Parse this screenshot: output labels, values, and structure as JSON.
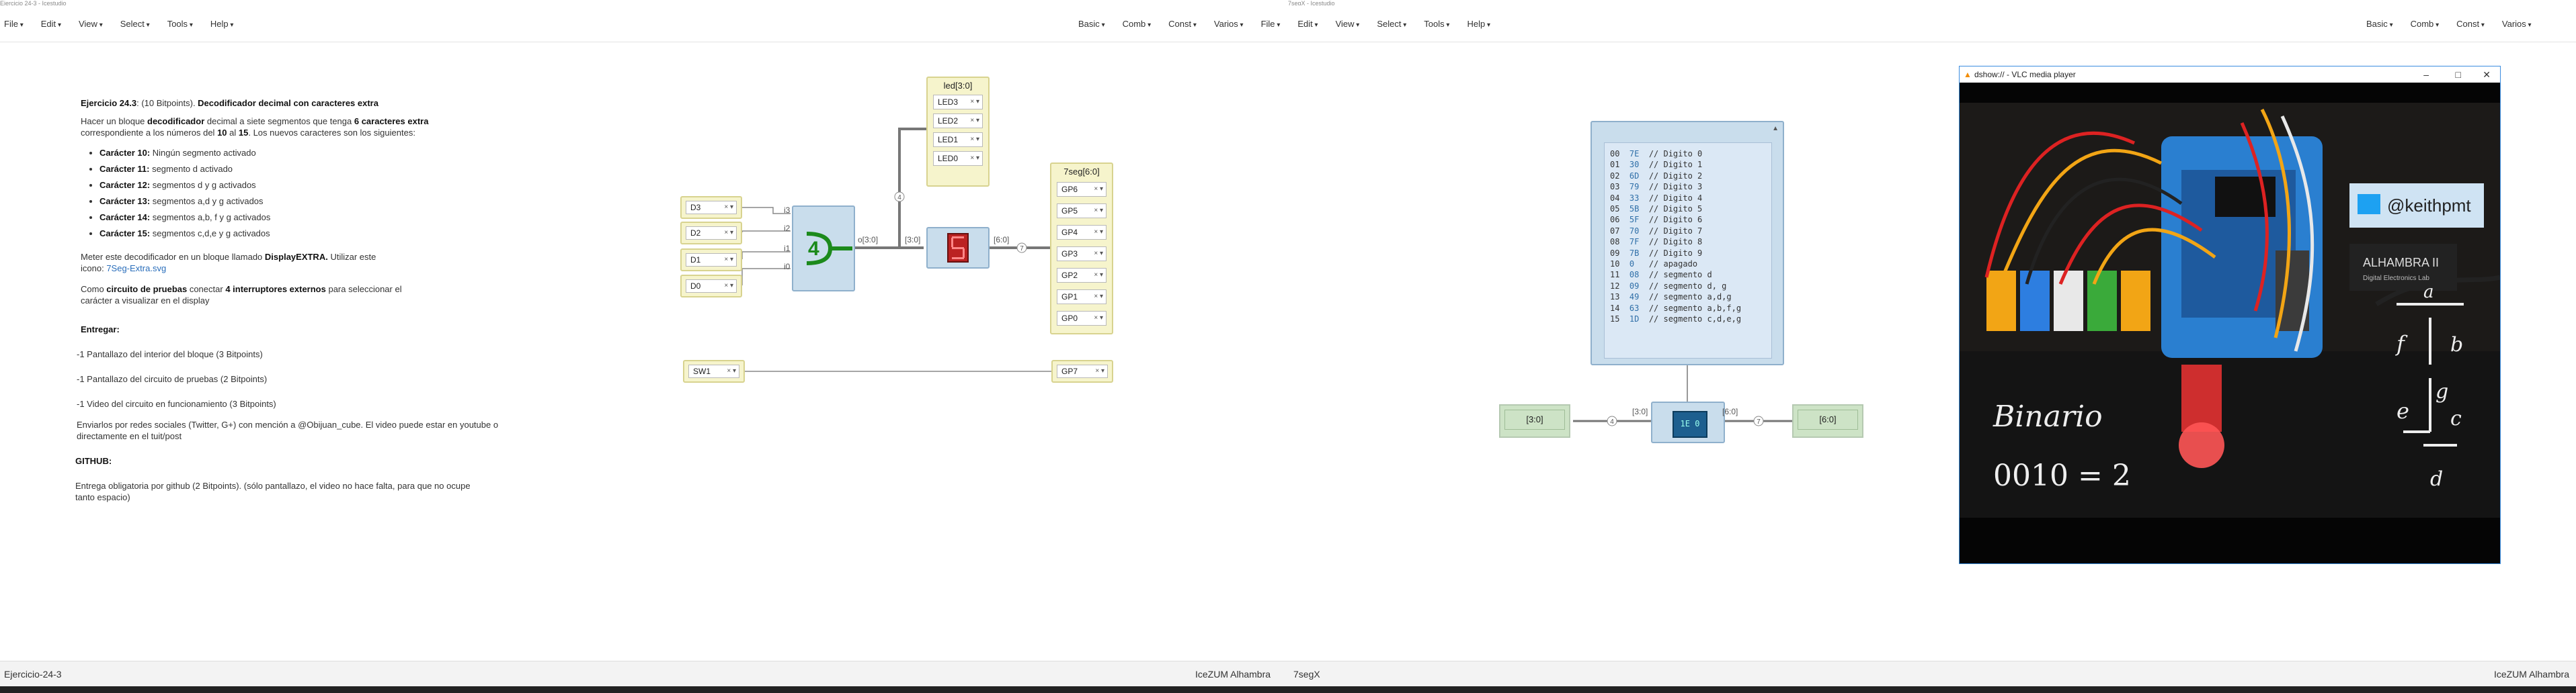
{
  "window_fragments": {
    "left": "Ejercicio 24-3 - Icestudio",
    "right": "7segX - Icestudio"
  },
  "menu_left": [
    "File",
    "Edit",
    "View",
    "Select",
    "Tools",
    "Help"
  ],
  "menu_mid": [
    "Basic",
    "Comb",
    "Const",
    "Varios",
    "File",
    "Edit",
    "View",
    "Select",
    "Tools",
    "Help"
  ],
  "menu_right": [
    "Basic",
    "Comb",
    "Const",
    "Varios"
  ],
  "instructions": {
    "title_label": "Ejercicio 24.3",
    "title_points": ": (10 Bitpoints). ",
    "title_bold": "Decodificador decimal con caracteres extra",
    "p1_a": "Hacer un bloque ",
    "p1_b": "decodificador",
    "p1_c": " decimal a siete segmentos que tenga ",
    "p1_d": "6 caracteres extra",
    "p1_e": " correspondiente a los números del ",
    "p1_f": "10",
    "p1_g": " al ",
    "p1_h": "15",
    "p1_i": ". Los nuevos caracteres son los siguientes:",
    "bullets": [
      {
        "b": "Carácter 10:",
        "t": " Ningún segmento activado"
      },
      {
        "b": "Carácter 11:",
        "t": " segmento d activado"
      },
      {
        "b": "Carácter 12:",
        "t": " segmentos d y g activados"
      },
      {
        "b": "Carácter 13:",
        "t": " segmentos a,d y g activados"
      },
      {
        "b": "Carácter 14:",
        "t": " segmentos a,b, f y g activados"
      },
      {
        "b": "Carácter 15:",
        "t": " segmentos c,d,e y g activados"
      }
    ],
    "p2_a": "Meter este decodificador en un bloque llamado ",
    "p2_b": "DisplayEXTRA.",
    "p2_c": " Utilizar este icono: ",
    "p2_link": "7Seg-Extra.svg",
    "p3_a": "Como ",
    "p3_b": "circuito de pruebas",
    "p3_c": " conectar ",
    "p3_d": "4 interruptores externos",
    "p3_e": " para seleccionar el carácter a visualizar en el display",
    "entregar": "Entregar:",
    "e1": "-1 Pantallazo del interior del bloque (3 Bitpoints)",
    "e2": "-1 Pantallazo del circuito de pruebas (2 Bitpoints)",
    "e3": "-1 Video del circuito en funcionamiento (3 Bitpoints)",
    "e4": "Enviarlos por redes sociales (Twitter, G+) con mención a @Obijuan_cube. El video puede estar en youtube o directamente en el tuit/post",
    "github": "GITHUB:",
    "g1": "Entrega obligatoria por github (2 Bitpoints). (sólo pantallazo, el video no hace falta, para que no ocupe tanto espacio)"
  },
  "circuit1": {
    "inputs": [
      "D3",
      "D2",
      "D1",
      "D0"
    ],
    "port_labels": [
      "i3",
      "i2",
      "i1",
      "i0"
    ],
    "mux_out": "o[3:0]",
    "bus_label": "[3:0]",
    "bus_out": "[6:0]",
    "led_group": {
      "title": "led[3:0]",
      "items": [
        "LED3",
        "LED2",
        "LED1",
        "LED0"
      ]
    },
    "seg_group": {
      "title": "7seg[6:0]",
      "items": [
        "GP6",
        "GP5",
        "GP4",
        "GP3",
        "GP2",
        "GP1",
        "GP0"
      ]
    },
    "sw": "SW1",
    "gp7": "GP7",
    "mux_number": "4",
    "wire_num_4": "4",
    "wire_num_7": "7"
  },
  "circuit2": {
    "code_rows": [
      [
        "00",
        "7E",
        "// Digito 0"
      ],
      [
        "01",
        "30",
        "// Digito 1"
      ],
      [
        "02",
        "6D",
        "// Digito 2"
      ],
      [
        "03",
        "79",
        "// Digito 3"
      ],
      [
        "04",
        "33",
        "// Digito 4"
      ],
      [
        "05",
        "5B",
        "// Digito 5"
      ],
      [
        "06",
        "5F",
        "// Digito 6"
      ],
      [
        "07",
        "70",
        "// Digito 7"
      ],
      [
        "08",
        "7F",
        "// Digito 8"
      ],
      [
        "09",
        "7B",
        "// Digito 9"
      ],
      [
        "10",
        "0",
        "// apagado"
      ],
      [
        "11",
        "08",
        "// segmento d"
      ],
      [
        "12",
        "09",
        "// segmento d, g"
      ],
      [
        "13",
        "49",
        "// segmento a,d,g"
      ],
      [
        "14",
        "63",
        "// segmento a,b,f,g"
      ],
      [
        "15",
        "1D",
        "// segmento c,d,e,g"
      ]
    ],
    "in_label": "[3:0]",
    "out_label": "[6:0]",
    "in_bus": "[3:0]",
    "out_bus": "[6:0]",
    "chip_text": "1E 0",
    "num_in": "4",
    "num_out": "7"
  },
  "vlc": {
    "title": "dshow:// - VLC media player",
    "twitter_handle": "@keithpmt",
    "board_label": "ALHAMBRA II",
    "board_sub": "Digital Electronics Lab",
    "chalk_word": "Binario",
    "chalk_eq": "0010 = 2",
    "chalk_fraction_top": "f",
    "chalk_a": "a",
    "chalk_b": "b",
    "chalk_e": "e",
    "chalk_g": "g",
    "chalk_c": "c",
    "chalk_d": "d"
  },
  "status": {
    "left": "Ejercicio-24-3",
    "mid_board": "IceZUM Alhambra",
    "mid_file": "7segX",
    "right_board": "IceZUM Alhambra"
  }
}
